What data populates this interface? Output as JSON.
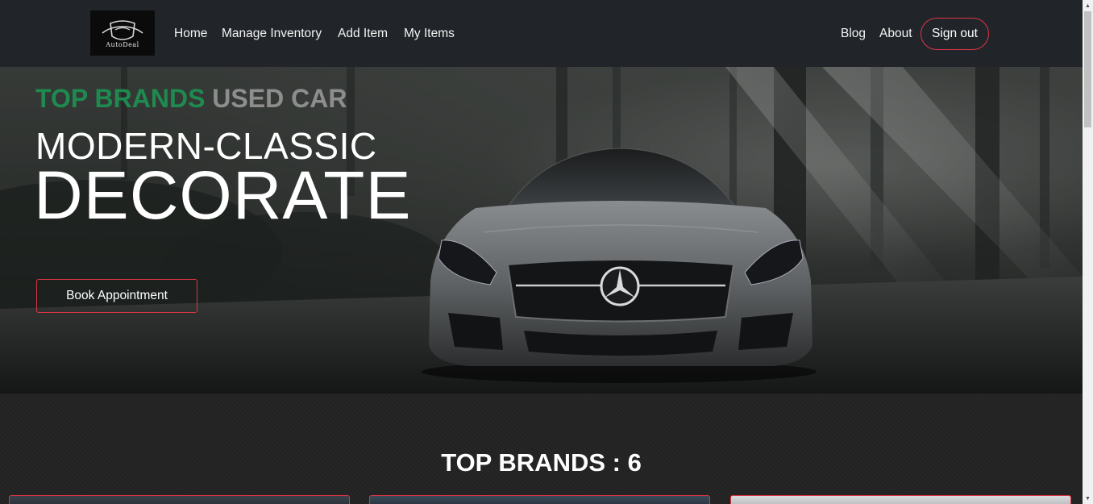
{
  "brand": {
    "logo_text": "AutoDeal"
  },
  "nav": {
    "home": "Home",
    "manage_inventory": "Manage Inventory",
    "add_item": "Add Item",
    "my_items": "My Items",
    "blog": "Blog",
    "about": "About",
    "sign_out": "Sign out"
  },
  "hero": {
    "tag_green": "TOP BRANDS",
    "tag_grey": "USED CAR",
    "subtitle": "MODERN-CLASSIC",
    "title": "DECORATE",
    "cta": "Book Appointment",
    "colors": {
      "green": "#1e8a4f",
      "accent": "#dc3545"
    }
  },
  "brands": {
    "heading": "TOP BRANDS : 6"
  },
  "scrollbar": {
    "up_icon": "scroll-up-arrow-icon",
    "down_icon": "scroll-down-arrow-icon"
  }
}
